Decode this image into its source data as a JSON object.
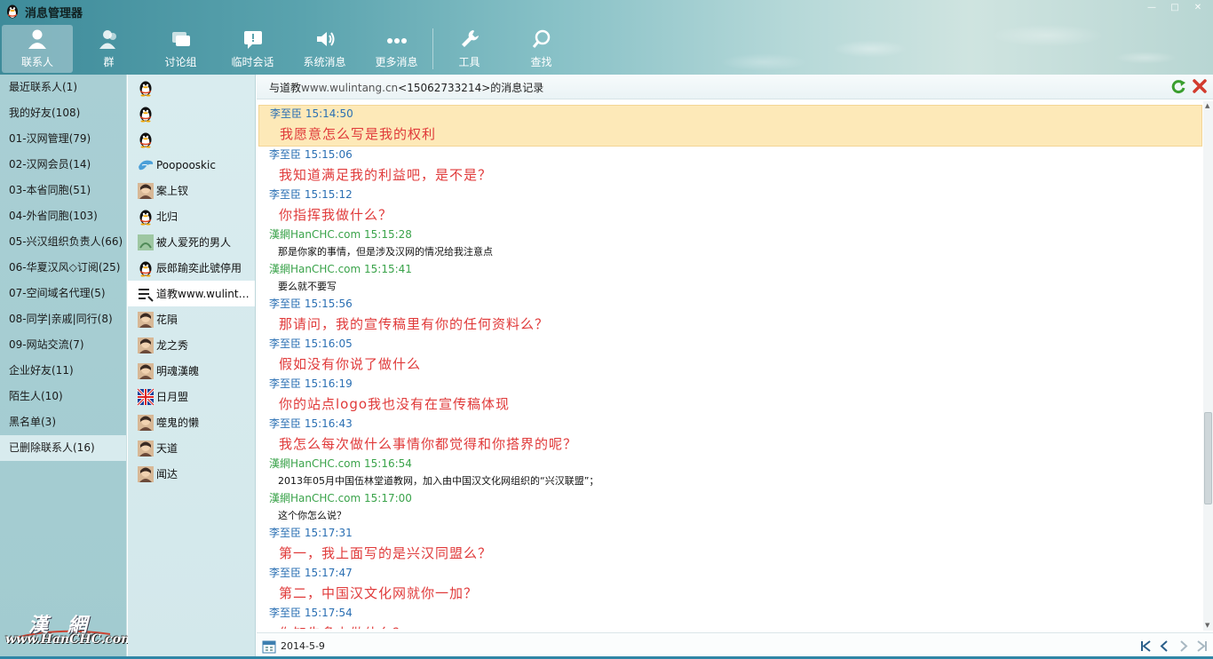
{
  "window": {
    "title": "消息管理器",
    "controls": [
      "—",
      "□",
      "✕"
    ]
  },
  "toolbar": {
    "tabs": [
      {
        "label": "联系人",
        "icon": "contact-person-icon"
      },
      {
        "label": "群",
        "icon": "group-icon"
      },
      {
        "label": "讨论组",
        "icon": "discussion-icon"
      },
      {
        "label": "临时会话",
        "icon": "temp-session-icon"
      },
      {
        "label": "系统消息",
        "icon": "speaker-icon"
      },
      {
        "label": "更多消息",
        "icon": "more-icon"
      },
      {
        "label": "工具",
        "icon": "wrench-icon"
      },
      {
        "label": "查找",
        "icon": "search-icon"
      }
    ]
  },
  "groups": {
    "items": [
      "最近联系人(1)",
      "我的好友(108)",
      "01-汉网管理(79)",
      "02-汉网会员(14)",
      "03-本省同胞(51)",
      "04-外省同胞(103)",
      "05-兴汉组织负责人(66)",
      "06-华夏汉风◇订阅(25)",
      "07-空间域名代理(5)",
      "08-同学|亲戚|同行(8)",
      "09-网站交流(7)",
      "企业好友(11)",
      "陌生人(10)",
      "黑名单(3)",
      "已删除联系人(16)"
    ],
    "selected_index": 14
  },
  "watermark": {
    "top": "漢網",
    "bottom": "www.HanCHC.com"
  },
  "contacts": {
    "items": [
      {
        "name": "",
        "avatar": "penguin-icon"
      },
      {
        "name": "",
        "avatar": "penguin-icon"
      },
      {
        "name": "",
        "avatar": "penguin-icon"
      },
      {
        "name": "Poopooskic",
        "avatar": "dolphin-avatar-icon"
      },
      {
        "name": "案上钗",
        "avatar": "portrait-avatar-icon"
      },
      {
        "name": "北归",
        "avatar": "penguin-icon"
      },
      {
        "name": "被人爱死的男人",
        "avatar": "green-avatar-icon"
      },
      {
        "name": "辰郎踰奕此號停用",
        "avatar": "penguin-icon"
      },
      {
        "name": "道教www.wulintang.cn",
        "avatar": "list-icon"
      },
      {
        "name": "花隕",
        "avatar": "portrait-avatar-icon"
      },
      {
        "name": "龙之秀",
        "avatar": "portrait-avatar-icon"
      },
      {
        "name": "明魂漢魄",
        "avatar": "portrait-avatar-icon"
      },
      {
        "name": "日月盟",
        "avatar": "flag-avatar-icon"
      },
      {
        "name": "噬鬼的懒",
        "avatar": "portrait-avatar-icon"
      },
      {
        "name": "天道",
        "avatar": "portrait-avatar-icon"
      },
      {
        "name": "闻达",
        "avatar": "portrait-avatar-icon"
      }
    ],
    "selected_index": 8
  },
  "panel": {
    "title_prefix": "与道教",
    "title_site": "www.wulintang.cn",
    "title_suffix": "<15062733214>的消息记录",
    "footer_date": "2014-5-9"
  },
  "messages": [
    {
      "meta": "李至臣 15:14:50",
      "text": "我愿意怎么写是我的权利",
      "who": "li",
      "highlight": true
    },
    {
      "meta": "李至臣 15:15:06",
      "text": "我知道满足我的利益吧，是不是？",
      "who": "li"
    },
    {
      "meta": "李至臣 15:15:12",
      "text": "你指挥我做什么？",
      "who": "li"
    },
    {
      "meta": "漢網HanCHC.com 15:15:28",
      "text": "那是你家的事情，但是涉及汉网的情况给我注意点",
      "who": "han"
    },
    {
      "meta": "漢網HanCHC.com 15:15:41",
      "text": "要么就不要写",
      "who": "han"
    },
    {
      "meta": "李至臣 15:15:56",
      "text": "那请问，我的宣传稿里有你的任何资料么？",
      "who": "li"
    },
    {
      "meta": "李至臣 15:16:05",
      "text": "假如没有你说了做什么",
      "who": "li"
    },
    {
      "meta": "李至臣 15:16:19",
      "text": "你的站点logo我也没有在宣传稿体现",
      "who": "li"
    },
    {
      "meta": "李至臣 15:16:43",
      "text": "我怎么每次做什么事情你都觉得和你搭界的呢？",
      "who": "li"
    },
    {
      "meta": "漢網HanCHC.com 15:16:54",
      "text": "2013年05月中国伍林堂道教网，加入由中国汉文化网组织的“兴汉联盟”；",
      "who": "han"
    },
    {
      "meta": "漢網HanCHC.com 15:17:00",
      "text": "这个你怎么说？",
      "who": "han"
    },
    {
      "meta": "李至臣 15:17:31",
      "text": "第一，我上面写的是兴汉同盟么？",
      "who": "li"
    },
    {
      "meta": "李至臣 15:17:47",
      "text": "第二，中国汉文化网就你一加？",
      "who": "li"
    },
    {
      "meta": "李至臣 15:17:54",
      "text": "你知先多少做什么？",
      "who": "li"
    }
  ]
}
